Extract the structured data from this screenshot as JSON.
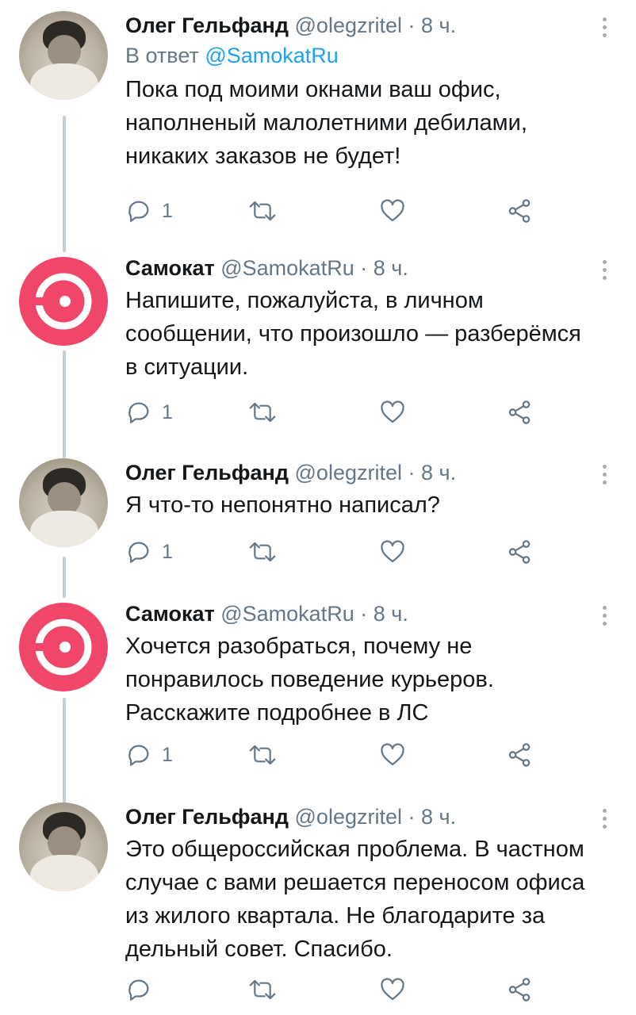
{
  "tweets": [
    {
      "name": "Олег Гельфанд",
      "handle": "@olegzritel",
      "dot": "·",
      "time": "8 ч.",
      "reply_prefix": "В ответ",
      "reply_mention": "@SamokatRu",
      "lines": [
        "Пока под моими окнами ваш офис,",
        "наполненый малолетними дебилами,",
        "никаких заказов не будет!"
      ],
      "reply_count": "1",
      "avatar": "user-photo"
    },
    {
      "name": "Самокат",
      "handle": "@SamokatRu",
      "dot": "·",
      "time": "8 ч.",
      "lines": [
        "Напишите, пожалуйста, в личном",
        "сообщении, что произошло — разберёмся",
        "в ситуации."
      ],
      "reply_count": "1",
      "avatar": "samokat-logo"
    },
    {
      "name": "Олег Гельфанд",
      "handle": "@olegzritel",
      "dot": "·",
      "time": "8 ч.",
      "lines": [
        "Я что-то непонятно написал?"
      ],
      "reply_count": "1",
      "avatar": "user-photo"
    },
    {
      "name": "Самокат",
      "handle": "@SamokatRu",
      "dot": "·",
      "time": "8 ч.",
      "lines": [
        "Хочется разобраться, почему не",
        "понравилось поведение курьеров.",
        "Расскажите подробнее в ЛС"
      ],
      "reply_count": "1",
      "avatar": "samokat-logo"
    },
    {
      "name": "Олег Гельфанд",
      "handle": "@olegzritel",
      "dot": "·",
      "time": "8 ч.",
      "lines": [
        "Это общероссийская проблема. В частном",
        "случае с вами решается переносом офиса",
        "из жилого квартала. Не благодарите за",
        "дельный совет. Спасибо."
      ],
      "reply_count": "",
      "avatar": "user-photo"
    }
  ],
  "icons": {
    "reply": "reply-icon",
    "retweet": "retweet-icon",
    "like": "heart-icon",
    "share": "share-icon",
    "more": "more-vertical-icon"
  },
  "colors": {
    "brand": "#f0466a",
    "link": "#1da1f2",
    "secondary_text": "#657786",
    "thread_line": "#c4cfd6"
  }
}
